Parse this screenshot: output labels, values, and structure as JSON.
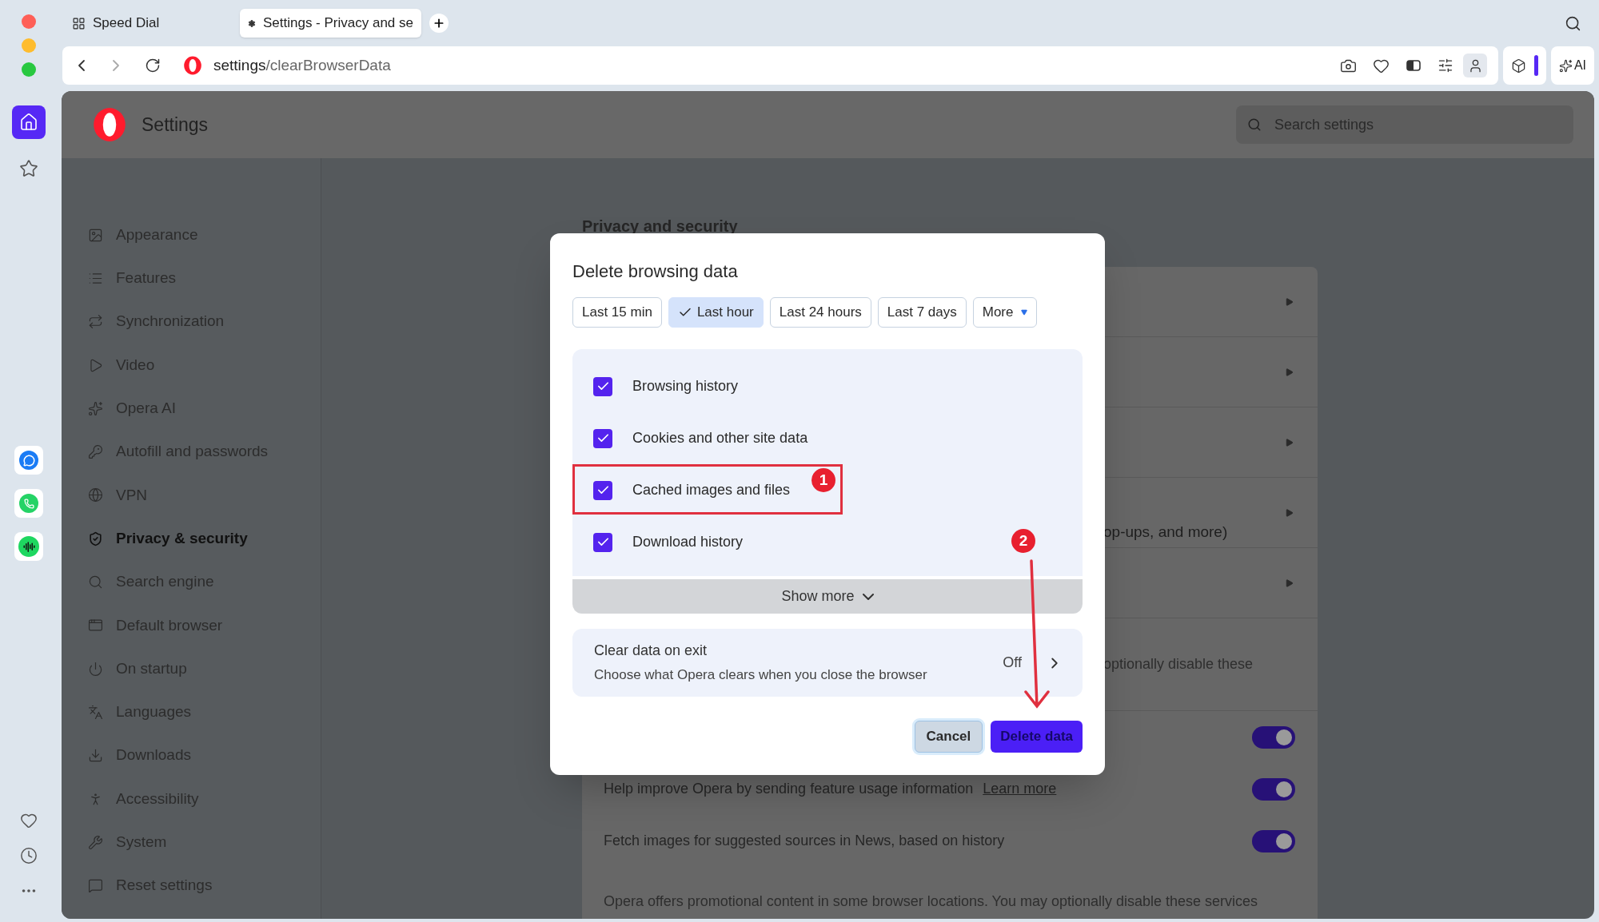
{
  "browser": {
    "tabs": [
      {
        "label": "Speed Dial",
        "selected": false
      },
      {
        "label": "Settings - Privacy and se",
        "selected": true
      }
    ],
    "address": {
      "host": "settings",
      "path": "/clearBrowserData"
    },
    "ai_button": "AI"
  },
  "rail": [
    {
      "kind": "home",
      "selected": true
    },
    {
      "kind": "bookmarks",
      "selected": false
    }
  ],
  "settings": {
    "title": "Settings",
    "search": {
      "placeholder": "Search settings"
    },
    "nav": [
      {
        "label": "Appearance",
        "selected": false
      },
      {
        "label": "Features",
        "selected": false
      },
      {
        "label": "Synchronization",
        "selected": false
      },
      {
        "label": "Video",
        "selected": false
      },
      {
        "label": "Opera AI",
        "selected": false
      },
      {
        "label": "Autofill and passwords",
        "selected": false
      },
      {
        "label": "VPN",
        "selected": false
      },
      {
        "label": "Privacy & security",
        "selected": true
      },
      {
        "label": "Search engine",
        "selected": false
      },
      {
        "label": "Default browser",
        "selected": false
      },
      {
        "label": "On startup",
        "selected": false
      },
      {
        "label": "Languages",
        "selected": false
      },
      {
        "label": "Downloads",
        "selected": false
      },
      {
        "label": "Accessibility",
        "selected": false
      },
      {
        "label": "System",
        "selected": false
      },
      {
        "label": "Reset settings",
        "selected": false
      }
    ],
    "section_title": "Privacy and security",
    "rows": [
      {
        "kind": "link"
      },
      {
        "kind": "link"
      },
      {
        "kind": "link"
      },
      {
        "kind": "link",
        "text": "op-ups, and more)"
      },
      {
        "kind": "link"
      },
      {
        "kind": "note",
        "text": "optionally disable these"
      },
      {
        "kind": "toggle",
        "on": true
      },
      {
        "kind": "toggle",
        "on": true,
        "text": "Help improve Opera by sending feature usage information",
        "link": "Learn more"
      },
      {
        "kind": "toggle",
        "on": true,
        "text": "Fetch images for suggested sources in News, based on history"
      },
      {
        "kind": "note",
        "text": "Opera offers promotional content in some browser locations. You may optionally disable these services"
      }
    ]
  },
  "dialog": {
    "title": "Delete browsing data",
    "ranges": [
      {
        "label": "Last 15 min",
        "selected": false
      },
      {
        "label": "Last hour",
        "selected": true
      },
      {
        "label": "Last 24 hours",
        "selected": false
      },
      {
        "label": "Last 7 days",
        "selected": false
      }
    ],
    "more": "More",
    "items": [
      {
        "label": "Browsing history",
        "checked": true
      },
      {
        "label": "Cookies and other site data",
        "checked": true
      },
      {
        "label": "Cached images and files",
        "checked": true
      },
      {
        "label": "Download history",
        "checked": true
      }
    ],
    "show_more": "Show more",
    "clear_on_exit": {
      "title": "Clear data on exit",
      "description": "Choose what Opera clears when you close the browser",
      "value": "Off"
    },
    "cancel": "Cancel",
    "confirm": "Delete data"
  },
  "annotations": [
    {
      "kind": "highlight",
      "label": "1"
    },
    {
      "kind": "arrow",
      "label": "2"
    }
  ]
}
